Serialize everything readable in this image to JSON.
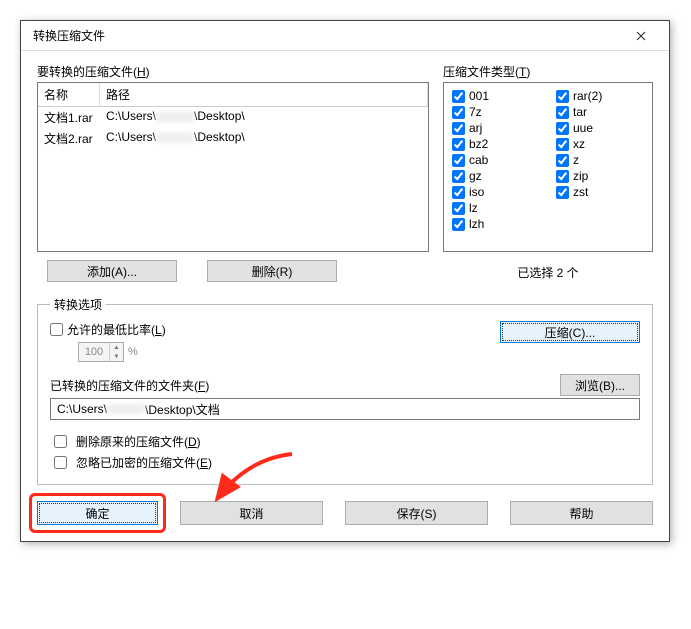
{
  "title": "转换压缩文件",
  "files_section": {
    "label_pre": "要转换的压缩文件(",
    "label_key": "H",
    "label_post": ")",
    "col_name": "名称",
    "col_path": "路径",
    "rows": [
      {
        "name": "文档1.rar",
        "path_prefix": "C:\\Users\\",
        "path_suffix": "\\Desktop\\"
      },
      {
        "name": "文档2.rar",
        "path_prefix": "C:\\Users\\",
        "path_suffix": "\\Desktop\\"
      }
    ],
    "add_label": "添加(A)...",
    "remove_label": "删除(R)"
  },
  "types_section": {
    "label_pre": "压缩文件类型(",
    "label_key": "T",
    "label_post": ")",
    "col1": [
      "001",
      "7z",
      "arj",
      "bz2",
      "cab",
      "gz",
      "iso",
      "lz",
      "lzh"
    ],
    "col2": [
      "rar(2)",
      "tar",
      "uue",
      "xz",
      "z",
      "zip",
      "zst"
    ],
    "selected_text": "已选择 2 个"
  },
  "options": {
    "legend": "转换选项",
    "min_ratio_pre": "允许的最低比率(",
    "min_ratio_key": "L",
    "min_ratio_post": ")",
    "ratio_value": "100",
    "ratio_pct": "%",
    "compress_label": "压缩(C)...",
    "folder_label_pre": "已转换的压缩文件的文件夹(",
    "folder_label_key": "F",
    "folder_label_post": ")",
    "browse_label": "浏览(B)...",
    "folder_value_prefix": "C:\\Users\\",
    "folder_value_suffix": "\\Desktop\\文档",
    "delete_orig_pre": "删除原来的压缩文件(",
    "delete_orig_key": "D",
    "delete_orig_post": ")",
    "skip_encrypted_pre": "忽略已加密的压缩文件(",
    "skip_encrypted_key": "E",
    "skip_encrypted_post": ")"
  },
  "buttons": {
    "ok": "确定",
    "cancel": "取消",
    "save": "保存(S)",
    "help": "帮助"
  }
}
